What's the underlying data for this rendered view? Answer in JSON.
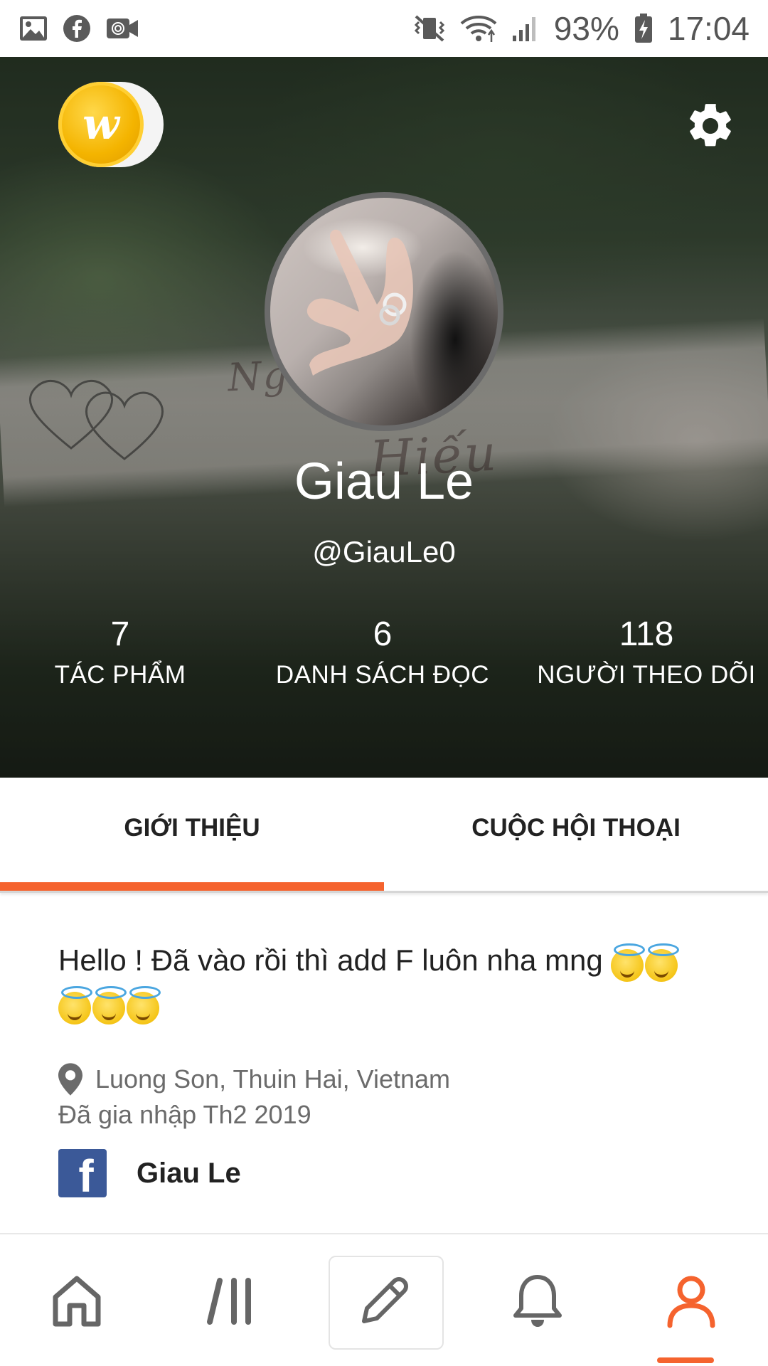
{
  "status_bar": {
    "battery": "93%",
    "time": "17:04",
    "left_icons": [
      "gallery-icon",
      "facebook-icon",
      "video-camera-icon"
    ],
    "right_icons": [
      "vibrate-icon",
      "wifi-icon",
      "signal-icon",
      "battery-charging-icon"
    ]
  },
  "header": {
    "coin_letter": "w",
    "avatar": "profile-photo",
    "name": "Giau Le",
    "handle": "@GiauLe0",
    "cover_text_1": "Ng        ương lên",
    "cover_text_2": "Hiếu"
  },
  "stats": [
    {
      "value": "7",
      "label": "TÁC PHẨM"
    },
    {
      "value": "6",
      "label": "DANH SÁCH ĐỌC"
    },
    {
      "value": "118",
      "label": "NGƯỜI THEO DÕI"
    }
  ],
  "tabs": [
    {
      "label": "GIỚI THIỆU",
      "active": true
    },
    {
      "label": "CUỘC HỘI THOẠI",
      "active": false
    }
  ],
  "about": {
    "bio": "Hello ! Đã vào rồi thì add F luôn nha mng",
    "emoji_count": 5,
    "location": "Luong Son, Thuin Hai, Vietnam",
    "joined": "Đã gia nhập Th2 2019",
    "facebook_name": "Giau Le"
  },
  "bottom_nav": [
    {
      "icon": "home-icon",
      "active": false
    },
    {
      "icon": "library-icon",
      "active": false
    },
    {
      "icon": "pencil-icon",
      "active": false
    },
    {
      "icon": "bell-icon",
      "active": false
    },
    {
      "icon": "profile-icon",
      "active": true
    }
  ],
  "colors": {
    "accent": "#f5632e",
    "facebook": "#3b5998",
    "coin": "#f4b400"
  }
}
